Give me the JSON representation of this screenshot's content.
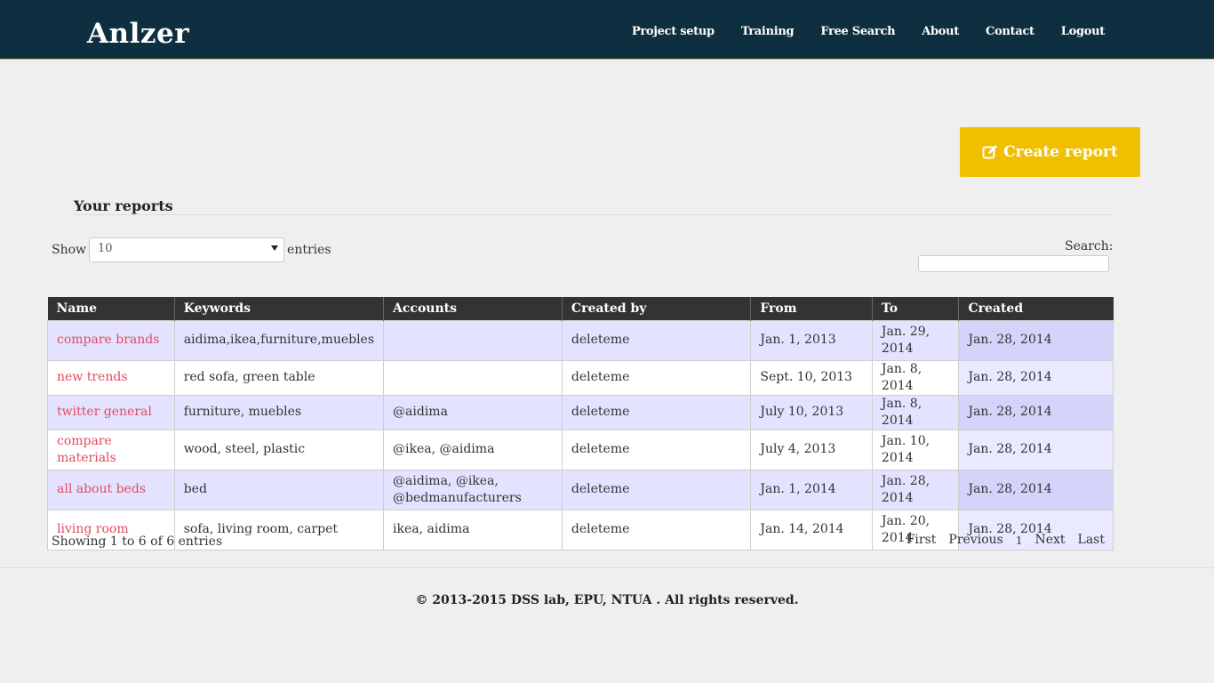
{
  "brand": "Anlzer",
  "nav": [
    "Project setup",
    "Training",
    "Free Search",
    "About",
    "Contact",
    "Logout"
  ],
  "create_button": "Create report",
  "section_title": "Your reports",
  "length": {
    "show_label": "Show",
    "value": "10",
    "entries_label": "entries"
  },
  "search": {
    "label": "Search:",
    "value": ""
  },
  "table": {
    "columns": [
      "Name",
      "Keywords",
      "Accounts",
      "Created by",
      "From",
      "To",
      "Created"
    ],
    "rows": [
      {
        "name": "compare brands",
        "keywords": "aidima,ikea,furniture,muebles",
        "accounts": "",
        "created_by": "deleteme",
        "from": "Jan. 1, 2013",
        "to": "Jan. 29, 2014",
        "created": "Jan. 28, 2014"
      },
      {
        "name": "new trends",
        "keywords": "red sofa, green table",
        "accounts": "",
        "created_by": "deleteme",
        "from": "Sept. 10, 2013",
        "to": "Jan. 8, 2014",
        "created": "Jan. 28, 2014"
      },
      {
        "name": "twitter general",
        "keywords": "furniture, muebles",
        "accounts": "@aidima",
        "created_by": "deleteme",
        "from": "July 10, 2013",
        "to": "Jan. 8, 2014",
        "created": "Jan. 28, 2014"
      },
      {
        "name": "compare materials",
        "keywords": "wood, steel, plastic",
        "accounts": "@ikea, @aidima",
        "created_by": "deleteme",
        "from": "July 4, 2013",
        "to": "Jan. 10, 2014",
        "created": "Jan. 28, 2014"
      },
      {
        "name": "all about beds",
        "keywords": "bed",
        "accounts": "@aidima, @ikea, @bedmanufacturers",
        "created_by": "deleteme",
        "from": "Jan. 1, 2014",
        "to": "Jan. 28, 2014",
        "created": "Jan. 28, 2014"
      },
      {
        "name": "living room",
        "keywords": "sofa, living room, carpet",
        "accounts": "ikea, aidima",
        "created_by": "deleteme",
        "from": "Jan. 14, 2014",
        "to": "Jan. 20, 2014",
        "created": "Jan. 28, 2014"
      }
    ]
  },
  "info": "Showing 1 to 6 of 6 entries",
  "pagination": {
    "first": "First",
    "previous": "Previous",
    "current": "1",
    "next": "Next",
    "last": "Last"
  },
  "footer": "© 2013-2015 DSS lab, EPU, NTUA . All rights reserved.",
  "colors": {
    "navbar": "#0e2f3f",
    "accent": "#f0c000",
    "link": "#e24a5c",
    "row_odd": "#e3e3ff"
  }
}
